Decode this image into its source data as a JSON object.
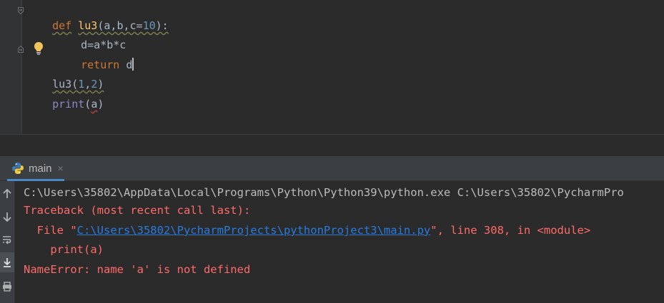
{
  "editor": {
    "line1": {
      "def": "def",
      "space": " ",
      "name": "lu3",
      "open": "(",
      "p_a": "a",
      "c1": ",",
      "p_b": "b",
      "c2": ",",
      "p_c": "c",
      "eq": "=",
      "default": "10",
      "close": "):"
    },
    "line2": {
      "text": "d=a*b*c"
    },
    "line3": {
      "return": "return",
      "space": " ",
      "value": "d"
    },
    "line4": {
      "fn": "lu3",
      "open": "(",
      "arg1": "1",
      "comma": ",",
      "arg2": "2",
      "close": ")"
    },
    "line5": {
      "fn": "print",
      "open": "(",
      "arg": "a",
      "close": ")"
    }
  },
  "run_window": {
    "tab_label": "main",
    "tab_close": "×"
  },
  "console": {
    "command": "C:\\Users\\35802\\AppData\\Local\\Programs\\Python\\Python39\\python.exe C:\\Users\\35802\\PycharmPro",
    "traceback_header": "Traceback (most recent call last):",
    "file_prefix": "  File \"",
    "file_link": "C:\\Users\\35802\\PycharmProjects\\pythonProject3\\main.py",
    "file_suffix": "\", line 308, in <module>",
    "code_line": "    print(a)",
    "error": "NameError: name 'a' is not defined"
  },
  "colors": {
    "keyword": "#cc7832",
    "function": "#ffc66d",
    "number": "#6897bb",
    "error_text": "#ff6b68",
    "link": "#287bde",
    "tab_accent": "#4a88c7"
  },
  "icons": {
    "gutter_top": "fold-icon",
    "gutter_bottom": "fold-icon",
    "hint": "lightbulb-icon",
    "tab": "python-icon",
    "toolbar": [
      "arrow-up-icon",
      "arrow-down-icon",
      "soft-wrap-icon",
      "scroll-to-end-icon",
      "print-icon"
    ]
  }
}
